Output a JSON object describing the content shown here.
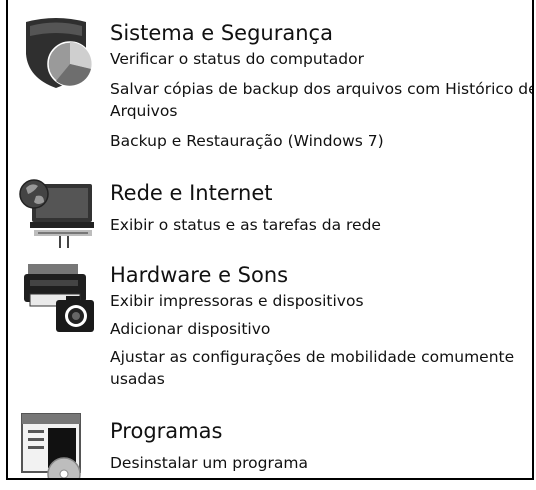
{
  "categories": [
    {
      "title": "Sistema e Segurança",
      "icon": "shield-pie-icon",
      "links": [
        "Verificar o status do computador",
        "Salvar cópias de backup dos arquivos com Histórico de Arquivos",
        "Backup e Restauração (Windows 7)"
      ]
    },
    {
      "title": "Rede e Internet",
      "icon": "network-globe-icon",
      "links": [
        "Exibir o status e as tarefas da rede"
      ]
    },
    {
      "title": "Hardware e Sons",
      "icon": "printer-camera-icon",
      "links": [
        "Exibir impressoras e dispositivos",
        "Adicionar dispositivo",
        "Ajustar as configurações de mobilidade comumente usadas"
      ]
    },
    {
      "title": "Programas",
      "icon": "programs-disc-icon",
      "links": [
        "Desinstalar um programa"
      ]
    }
  ]
}
